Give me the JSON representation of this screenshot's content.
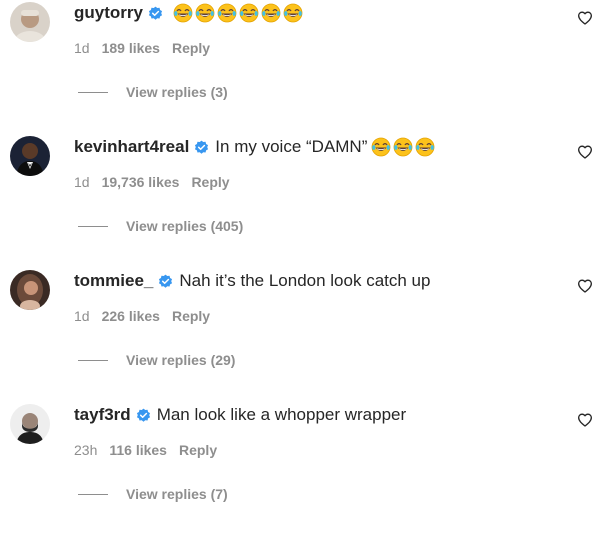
{
  "comments": [
    {
      "username": "guytorry",
      "text": "",
      "emoji_count": 6,
      "emoji_icon": "joy-emoji-icon",
      "time": "1d",
      "likes": "189 likes",
      "reply": "Reply",
      "view_replies": "View replies (3)"
    },
    {
      "username": "kevinhart4real",
      "text": "In my voice “DAMN”",
      "emoji_count": 3,
      "emoji_icon": "joy-emoji-icon",
      "time": "1d",
      "likes": "19,736 likes",
      "reply": "Reply",
      "view_replies": "View replies (405)"
    },
    {
      "username": "tommiee_",
      "text": "Nah it’s the London look catch up",
      "emoji_count": 0,
      "time": "1d",
      "likes": "226 likes",
      "reply": "Reply",
      "view_replies": "View replies (29)"
    },
    {
      "username": "tayf3rd",
      "text": "Man look like a whopper wrapper",
      "emoji_count": 0,
      "time": "23h",
      "likes": "116 likes",
      "reply": "Reply",
      "view_replies": "View replies (7)"
    }
  ],
  "colors": {
    "verified": "#3897f0",
    "text": "#262626",
    "secondary": "#8e8e8e"
  }
}
